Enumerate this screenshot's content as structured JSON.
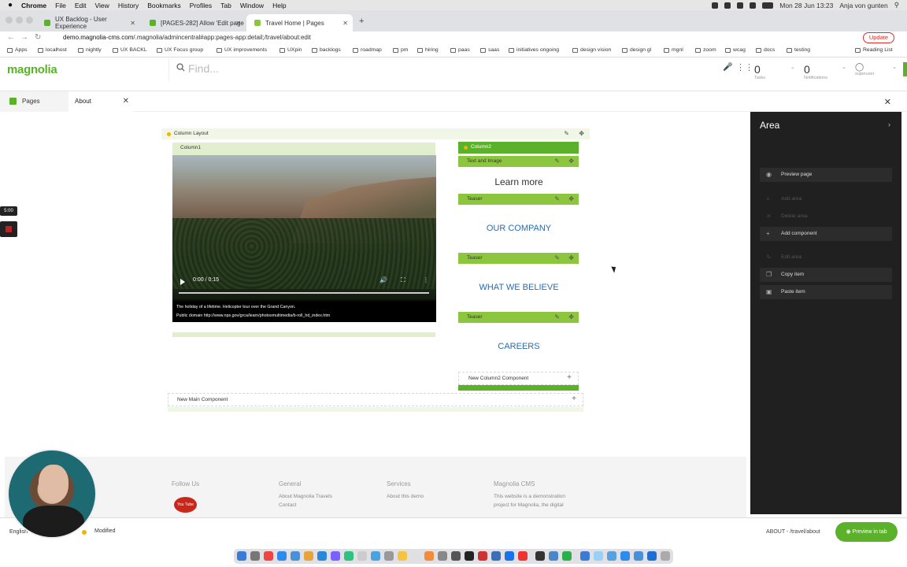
{
  "menubar": {
    "apple": "",
    "app": "Chrome",
    "items": [
      "File",
      "Edit",
      "View",
      "History",
      "Bookmarks",
      "Profiles",
      "Tab",
      "Window",
      "Help"
    ],
    "datetime": "Mon 28 Jun  13:23",
    "user": "Anja von gunten"
  },
  "browser": {
    "tabs": [
      {
        "title": "UX Backlog - User Experience",
        "color": "#5bb22a"
      },
      {
        "title": "[PAGES-282] Allow 'Edit page",
        "color": "#5bb22a"
      },
      {
        "title": "Travel Home | Pages",
        "color": "#8cc63f"
      }
    ],
    "url_host": "demo.magnolia-cms.com",
    "url_path": "/.magnolia/admincentral#app:pages-app:detail;/travel/about:edit",
    "update_label": "Update",
    "bookmarks": [
      "Apps",
      "localhost",
      "nightly",
      "UX BACKL",
      "UX Focus group",
      "UX improvements",
      "UXpin",
      "backlogs",
      "roadmap",
      "pm",
      "hiring",
      "paas",
      "saas",
      "initiatives ongoing",
      "design vision",
      "design gl",
      "mgnl",
      "zoom",
      "wcag",
      "docs",
      "testing"
    ],
    "reading_list": "Reading List"
  },
  "header": {
    "logo": "magnolia",
    "search_placeholder": "Find...",
    "tasks_count": "0",
    "tasks_label": "Tasks",
    "notifications_count": "0",
    "notifications_label": "Notifications",
    "user_label": "superuser"
  },
  "apptabs": {
    "pages_label": "Pages",
    "about_label": "About"
  },
  "editor": {
    "column_layout": "Column Layout",
    "column1": "Column1",
    "column2": "Column2",
    "text_and_image": "Text and Image",
    "learn_more": "Learn more",
    "teaser": "Teaser",
    "our_company": "OUR COMPANY",
    "what_we_believe": "WHAT WE BELIEVE",
    "careers": "CAREERS",
    "new_column2": "New Column2 Component",
    "new_main": "New Main Component",
    "video_time": "0:00 / 0:15",
    "video_caption_1": "The holiday of a lifetime. Helicopter tour over the Grand Canyon.",
    "video_caption_2": "Public domain http://www.nps.gov/grca/learn/photosmultimedia/b-roll_hd_index.htm"
  },
  "footer": {
    "follow_us": "Follow Us",
    "youtube_label": "You Tube",
    "general": "General",
    "about_travels": "About Magnolia Travels",
    "contact": "Contact",
    "services": "Services",
    "about_demo": "About this demo",
    "cms": "Magnolia CMS",
    "cms_text_1": "This website is a demonstration",
    "cms_text_2": "project for Magnolia, the digital"
  },
  "panel": {
    "title": "Area",
    "actions": [
      {
        "label": "Preview page",
        "enabled": true,
        "icon": "eye-icon"
      },
      {
        "label": "Add area",
        "enabled": false,
        "icon": "plus-icon"
      },
      {
        "label": "Delete area",
        "enabled": false,
        "icon": "close-icon"
      },
      {
        "label": "Add component",
        "enabled": true,
        "icon": "plus-icon"
      },
      {
        "label": "Edit area",
        "enabled": false,
        "icon": "pencil-icon"
      },
      {
        "label": "Copy item",
        "enabled": true,
        "icon": "copy-icon"
      },
      {
        "label": "Paste item",
        "enabled": true,
        "icon": "clipboard-icon"
      }
    ]
  },
  "status": {
    "language": "English",
    "modified": "Modified",
    "path": "ABOUT - /travel/about",
    "preview_tab": "Preview in tab"
  },
  "recorder": {
    "timer": "5:00"
  },
  "colors": {
    "brand_green": "#5bb22a",
    "light_green": "#8cc63f",
    "heading_blue": "#2a6bb0",
    "panel_bg": "#202020",
    "modified_dot": "#f0b400"
  }
}
